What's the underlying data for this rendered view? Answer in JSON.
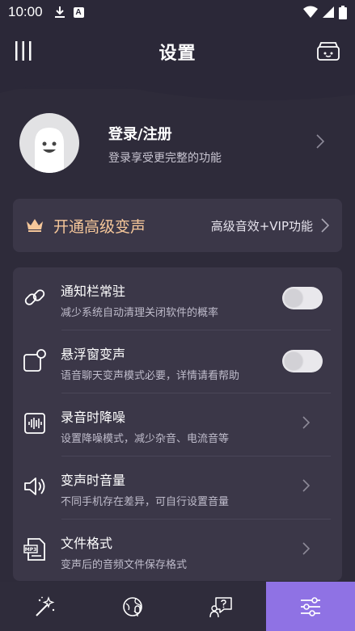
{
  "status_bar": {
    "time": "10:00",
    "a_badge": "A",
    "icons": [
      "download-icon",
      "a-badge-icon",
      "wifi-icon",
      "signal-icon",
      "battery-icon"
    ]
  },
  "header": {
    "title": "设置",
    "menu_icon": "menu-icon",
    "box_icon": "box-icon"
  },
  "profile": {
    "name": "登录/注册",
    "subtitle": "登录享受更完整的功能"
  },
  "vip": {
    "title": "开通高级变声",
    "right_text": "高级音效+VIP功能",
    "accent_color": "#f6c79a"
  },
  "settings": [
    {
      "title": "通知栏常驻",
      "subtitle": "减少系统自动清理关闭软件的概率",
      "control": "toggle",
      "on": false,
      "icon": "link-icon"
    },
    {
      "title": "悬浮窗变声",
      "subtitle": "语音聊天变声模式必要，详情请看帮助",
      "control": "toggle",
      "on": false,
      "icon": "floating-window-icon"
    },
    {
      "title": "录音时降噪",
      "subtitle": "设置降噪模式，减少杂音、电流音等",
      "control": "chevron",
      "icon": "noise-reduction-icon"
    },
    {
      "title": "变声时音量",
      "subtitle": "不同手机存在差异，可自行设置音量",
      "control": "chevron",
      "icon": "volume-icon"
    },
    {
      "title": "文件格式",
      "subtitle": "变声后的音频文件保存格式",
      "control": "chevron",
      "icon": "mp3-file-icon"
    }
  ],
  "file_icon_label": "MP3",
  "tabbar": {
    "tabs": [
      {
        "icon": "magic-wand-icon",
        "active": false
      },
      {
        "icon": "voice-globe-icon",
        "active": false
      },
      {
        "icon": "help-chat-icon",
        "active": false
      },
      {
        "icon": "sliders-icon",
        "active": true
      }
    ],
    "active_color": "#8f72e4"
  }
}
